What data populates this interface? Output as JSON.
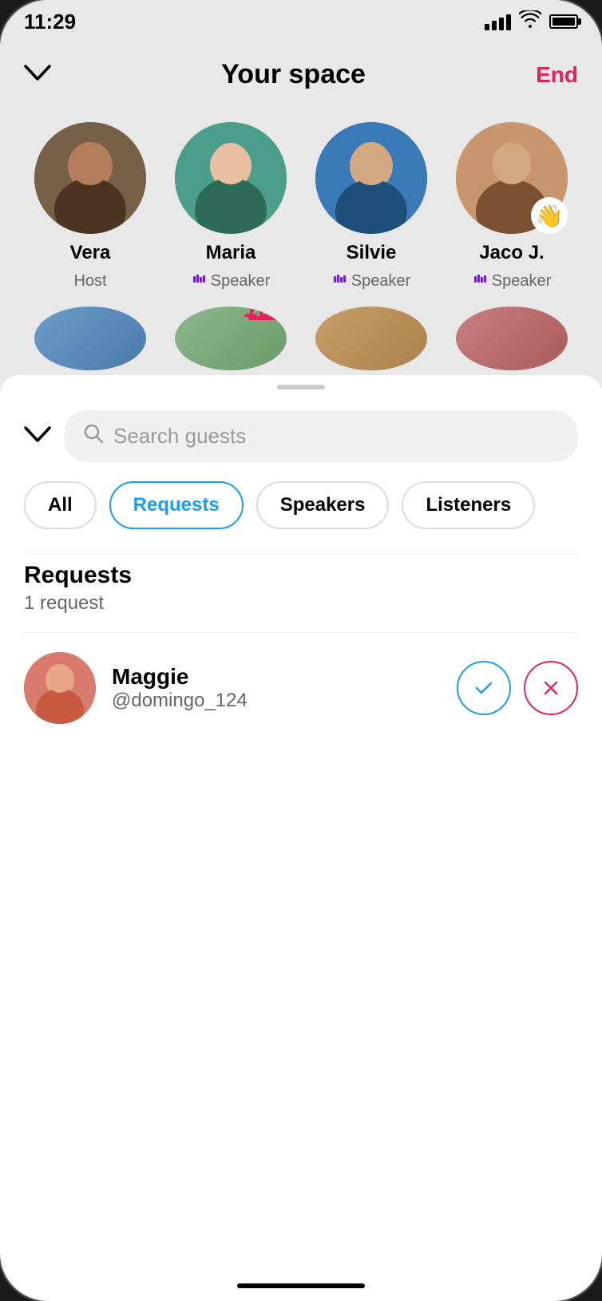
{
  "status_bar": {
    "time": "11:29",
    "signal_bars": [
      4,
      8,
      12,
      16,
      20
    ],
    "wifi": "📶",
    "battery": "🔋"
  },
  "header": {
    "title": "Your space",
    "end_label": "End",
    "chevron": "❮"
  },
  "speakers": [
    {
      "name": "Vera",
      "role": "Host",
      "has_mic": false,
      "avatar_class": "avatar-vera"
    },
    {
      "name": "Maria",
      "role": "Speaker",
      "has_mic": true,
      "avatar_class": "avatar-maria"
    },
    {
      "name": "Silvie",
      "role": "Speaker",
      "has_mic": true,
      "avatar_class": "avatar-silvie"
    },
    {
      "name": "Jaco J.",
      "role": "Speaker",
      "has_mic": true,
      "has_wave": true,
      "avatar_class": "avatar-jaco"
    }
  ],
  "bottom_speakers": [
    {
      "class": "avatar-b1"
    },
    {
      "class": "avatar-b2",
      "has_emoji": true
    },
    {
      "class": "avatar-b3"
    },
    {
      "class": "avatar-b4"
    }
  ],
  "search": {
    "placeholder": "Search guests"
  },
  "filter_tabs": [
    {
      "label": "All",
      "active": false
    },
    {
      "label": "Requests",
      "active": true
    },
    {
      "label": "Speakers",
      "active": false
    },
    {
      "label": "Listeners",
      "active": false
    }
  ],
  "requests_section": {
    "title": "Requests",
    "count": "1 request"
  },
  "requests": [
    {
      "name": "Maggie",
      "handle": "@domingo_124",
      "avatar_class": "avatar-maggie"
    }
  ],
  "actions": {
    "accept_icon": "✓",
    "reject_icon": "✕"
  }
}
